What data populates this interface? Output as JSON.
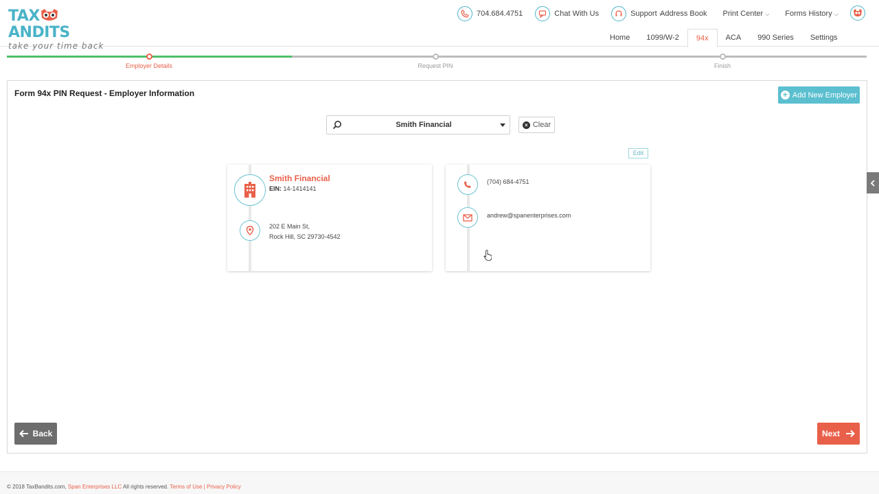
{
  "logo": {
    "brand": "TAXBANDITS",
    "brand_left": "TAX",
    "brand_right": "ANDITS",
    "tagline": "take your time back"
  },
  "header": {
    "phone": "704.684.4751",
    "chat": "Chat With Us",
    "support": "Support",
    "address_book": "Address Book",
    "print_center": "Print Center",
    "forms_history": "Forms History",
    "icons": [
      "phone-icon",
      "chat-icon",
      "support-icon",
      "avatar-icon"
    ]
  },
  "nav": {
    "tabs": [
      "Home",
      "1099/W-2",
      "94x",
      "ACA",
      "990 Series",
      "Settings"
    ],
    "active": "94x"
  },
  "stepper": {
    "steps": [
      "Employer Details",
      "Request PIN",
      "Finish"
    ],
    "current": 0
  },
  "panel": {
    "title": "Form 94x PIN Request - Employer Information",
    "add_button": "Add New Employer",
    "search_value": "Smith Financial",
    "clear_label": "Clear",
    "edit_label": "Edit"
  },
  "employer": {
    "name": "Smith Financial",
    "ein_label": "EIN:",
    "ein_value": "14-1414141",
    "address_line1": "202 E Main St,",
    "address_line2": "Rock Hill, SC 29730-4542",
    "phone": "(704) 684-4751",
    "email": "andrew@spanenterprises.com"
  },
  "buttons": {
    "back": "Back",
    "next": "Next"
  },
  "footer": {
    "copyright": "© 2018 TaxBandits.com,",
    "company": "Span Enterprises LLC",
    "rights": "All rights reserved.",
    "terms": "Terms of Use",
    "separator": "|",
    "privacy": "Privacy Policy"
  },
  "colors": {
    "accent": "#e9604a",
    "teal": "#5bbfcf",
    "progress_done": "#4cbf6a",
    "progress_todo": "#bbbbbb"
  }
}
